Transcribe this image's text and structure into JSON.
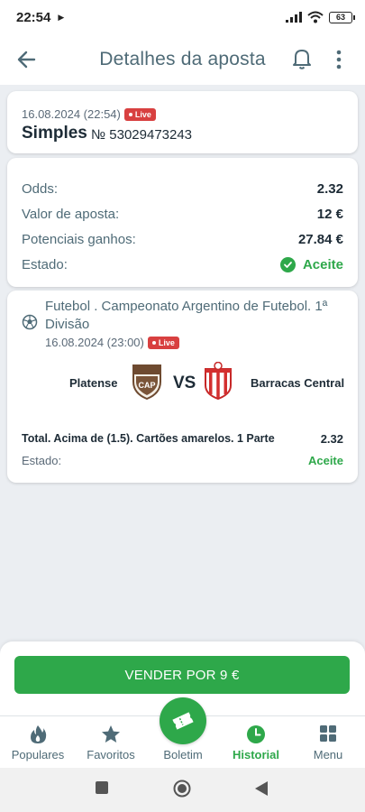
{
  "status_bar": {
    "time": "22:54",
    "battery": "63"
  },
  "header": {
    "title": "Detalhes da aposta"
  },
  "bet": {
    "date": "16.08.2024 (22:54)",
    "live_label": "Live",
    "type": "Simples",
    "number": "№ 53029473243"
  },
  "summary": {
    "odds_label": "Odds:",
    "odds_value": "2.32",
    "stake_label": "Valor de aposta:",
    "stake_value": "12 €",
    "potential_label": "Potenciais ganhos:",
    "potential_value": "27.84 €",
    "state_label": "Estado:",
    "state_value": "Aceite"
  },
  "event": {
    "league": "Futebol . Campeonato Argentino de Futebol. 1ª Divisão",
    "date": "16.08.2024 (23:00)",
    "live_label": "Live",
    "home_team": "Platense",
    "vs": "VS",
    "away_team": "Barracas Central",
    "market": "Total. Acima de (1.5). Cartões amarelos. 1 Parte",
    "market_odds": "2.32",
    "state_label": "Estado:",
    "state_value": "Aceite"
  },
  "sell_button": {
    "label": "VENDER POR 9 €"
  },
  "nav": {
    "items": [
      {
        "label": "Populares",
        "icon": "fire-icon"
      },
      {
        "label": "Favoritos",
        "icon": "star-icon"
      },
      {
        "label": "Boletim",
        "icon": "ticket-icon"
      },
      {
        "label": "Historial",
        "icon": "clock-icon"
      },
      {
        "label": "Menu",
        "icon": "grid-icon"
      }
    ],
    "active": "Historial"
  },
  "colors": {
    "accent": "#2ea84a",
    "live": "#d84040",
    "text_muted": "#4f6b77",
    "text_dark": "#1d2b36"
  }
}
